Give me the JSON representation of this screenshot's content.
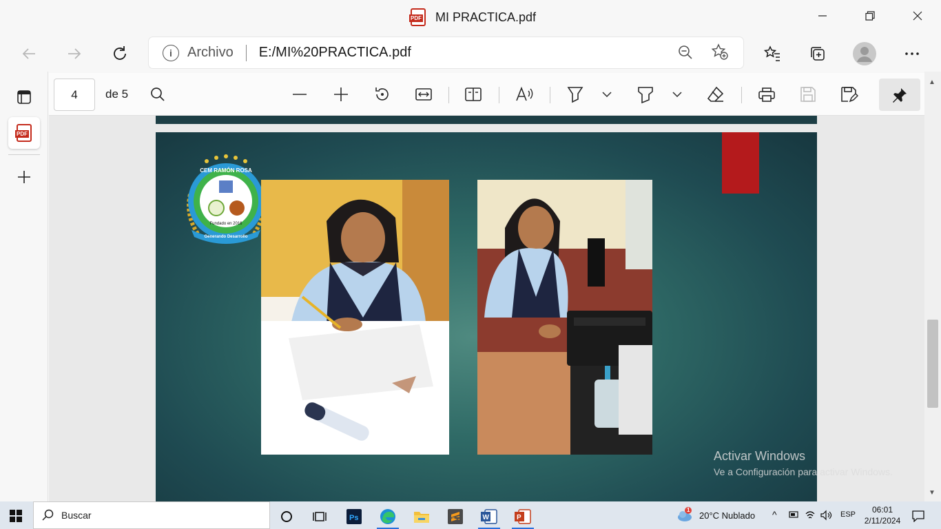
{
  "window": {
    "title": "MI PRACTICA.pdf",
    "minimize": "—",
    "maximize": "❐",
    "close": "✕"
  },
  "address_bar": {
    "scheme_label": "Archivo",
    "url": "E:/MI%20PRACTICA.pdf"
  },
  "pdf_toolbar": {
    "current_page": "4",
    "page_count": "de 5"
  },
  "slide": {
    "logo_text": "CEM RAMÓN ROSA",
    "logo_sub": "Fundado en 2016",
    "logo_ribbon": "Generando Desarrollo"
  },
  "watermark": {
    "line1": "Activar Windows",
    "line2": "Ve a Configuración para activar Windows."
  },
  "taskbar": {
    "search_placeholder": "Buscar",
    "weather": "20°C  Nublado",
    "weather_badge": "1",
    "language": "ESP",
    "time": "06:01",
    "date": "2/11/2024"
  },
  "colors": {
    "accent": "#2a6fdb",
    "slide_red": "#b41a1c",
    "slide_teal": "#2f6a66"
  }
}
